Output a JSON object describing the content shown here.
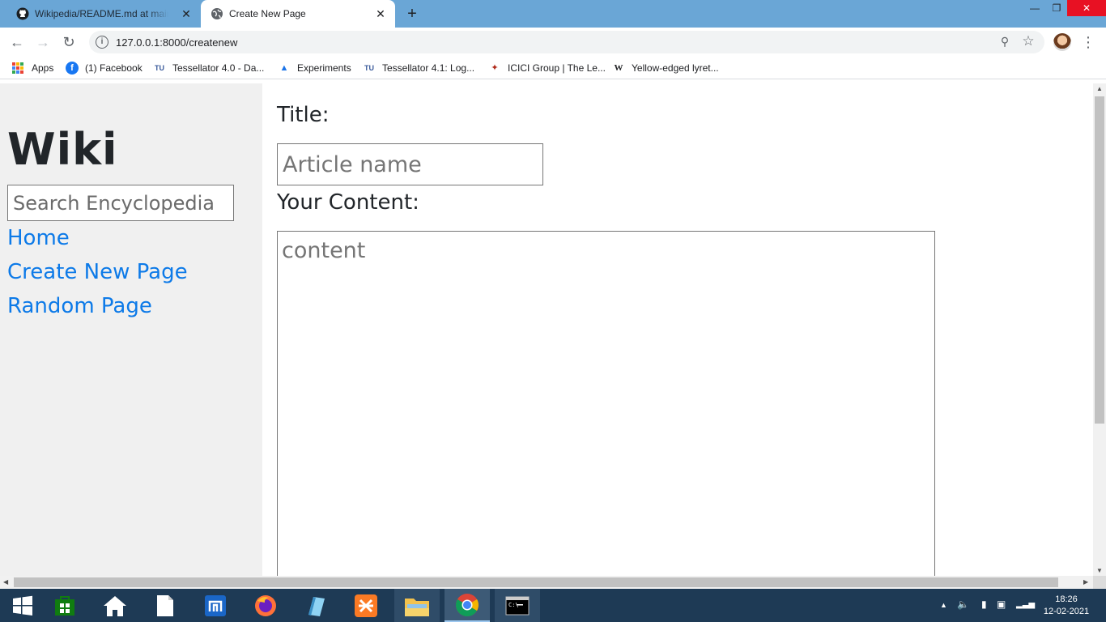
{
  "browser": {
    "tabs": [
      {
        "title": "Wikipedia/README.md at main · ",
        "active": false,
        "icon": "github-icon"
      },
      {
        "title": "Create New Page",
        "active": true,
        "icon": "globe-icon"
      }
    ],
    "new_tab_label": "+",
    "url": "127.0.0.1:8000/createnew",
    "bookmarks": [
      {
        "label": "Apps",
        "icon": "apps-grid-icon"
      },
      {
        "label": "(1) Facebook",
        "icon": "facebook-icon"
      },
      {
        "label": "Tessellator 4.0 - Da...",
        "icon": "tessellator-icon"
      },
      {
        "label": "Experiments",
        "icon": "flask-icon"
      },
      {
        "label": "Tessellator 4.1: Log...",
        "icon": "tessellator-icon"
      },
      {
        "label": "ICICI Group | The Le...",
        "icon": "icici-icon"
      },
      {
        "label": "Yellow-edged lyret...",
        "icon": "wikipedia-icon"
      }
    ]
  },
  "sidebar": {
    "title": "Wiki",
    "search_placeholder": "Search Encyclopedia",
    "links": [
      {
        "label": "Home"
      },
      {
        "label": "Create New Page"
      },
      {
        "label": "Random Page"
      }
    ]
  },
  "form": {
    "title_label": "Title:",
    "title_placeholder": "Article name",
    "content_label": "Your Content:",
    "content_placeholder": "content"
  },
  "taskbar": {
    "time": "18:26",
    "date": "12-02-2021",
    "apps": [
      "windows-start-icon",
      "store-icon",
      "home-icon",
      "file-icon",
      "maxthon-icon",
      "firefox-icon",
      "notepad-icon",
      "xampp-icon",
      "file-explorer-icon",
      "chrome-icon",
      "cmd-icon"
    ]
  },
  "colors": {
    "link": "#0d7ae8",
    "tab_strip": "#6aa6d6",
    "sidebar_bg": "#f0f0f0",
    "taskbar": "#1e3a55"
  }
}
